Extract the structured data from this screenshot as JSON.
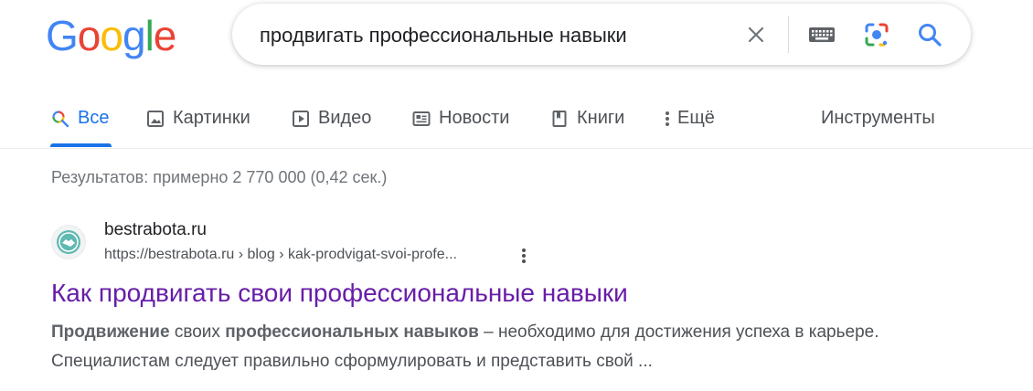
{
  "logo": {
    "letters": [
      "G",
      "o",
      "o",
      "g",
      "l",
      "e"
    ],
    "colors": [
      "#4285F4",
      "#EA4335",
      "#FBBC05",
      "#4285F4",
      "#34A853",
      "#EA4335"
    ]
  },
  "search": {
    "query": "продвигать профессиональные навыки"
  },
  "icons": {
    "clear": "close-icon",
    "keyboard": "keyboard-icon",
    "lens": "google-lens-icon",
    "search": "search-icon"
  },
  "tabs": [
    {
      "label": "Все",
      "icon": "search-icon",
      "active": true
    },
    {
      "label": "Картинки",
      "icon": "image-icon"
    },
    {
      "label": "Видео",
      "icon": "play-icon"
    },
    {
      "label": "Новости",
      "icon": "news-icon"
    },
    {
      "label": "Книги",
      "icon": "book-icon"
    },
    {
      "label": "Ещё",
      "icon": "more-vert-icon"
    }
  ],
  "tools_label": "Инструменты",
  "stats": "Результатов: примерно 2 770 000 (0,42 сек.)",
  "result": {
    "site_name": "bestrabota.ru",
    "url": "https://bestrabota.ru › blog › kak-prodvigat-svoi-profe...",
    "title": "Как продвигать свои профессиональные навыки",
    "snippet_bold1": "Продвижение",
    "snippet_text1": " своих ",
    "snippet_bold2": "профессиональных навыков",
    "snippet_text2": " – необходимо для достижения успеха в карьере. Специалистам следует правильно сформулировать и представить свой ..."
  },
  "colors": {
    "accent": "#1a73e8",
    "visited_link": "#681da8"
  }
}
